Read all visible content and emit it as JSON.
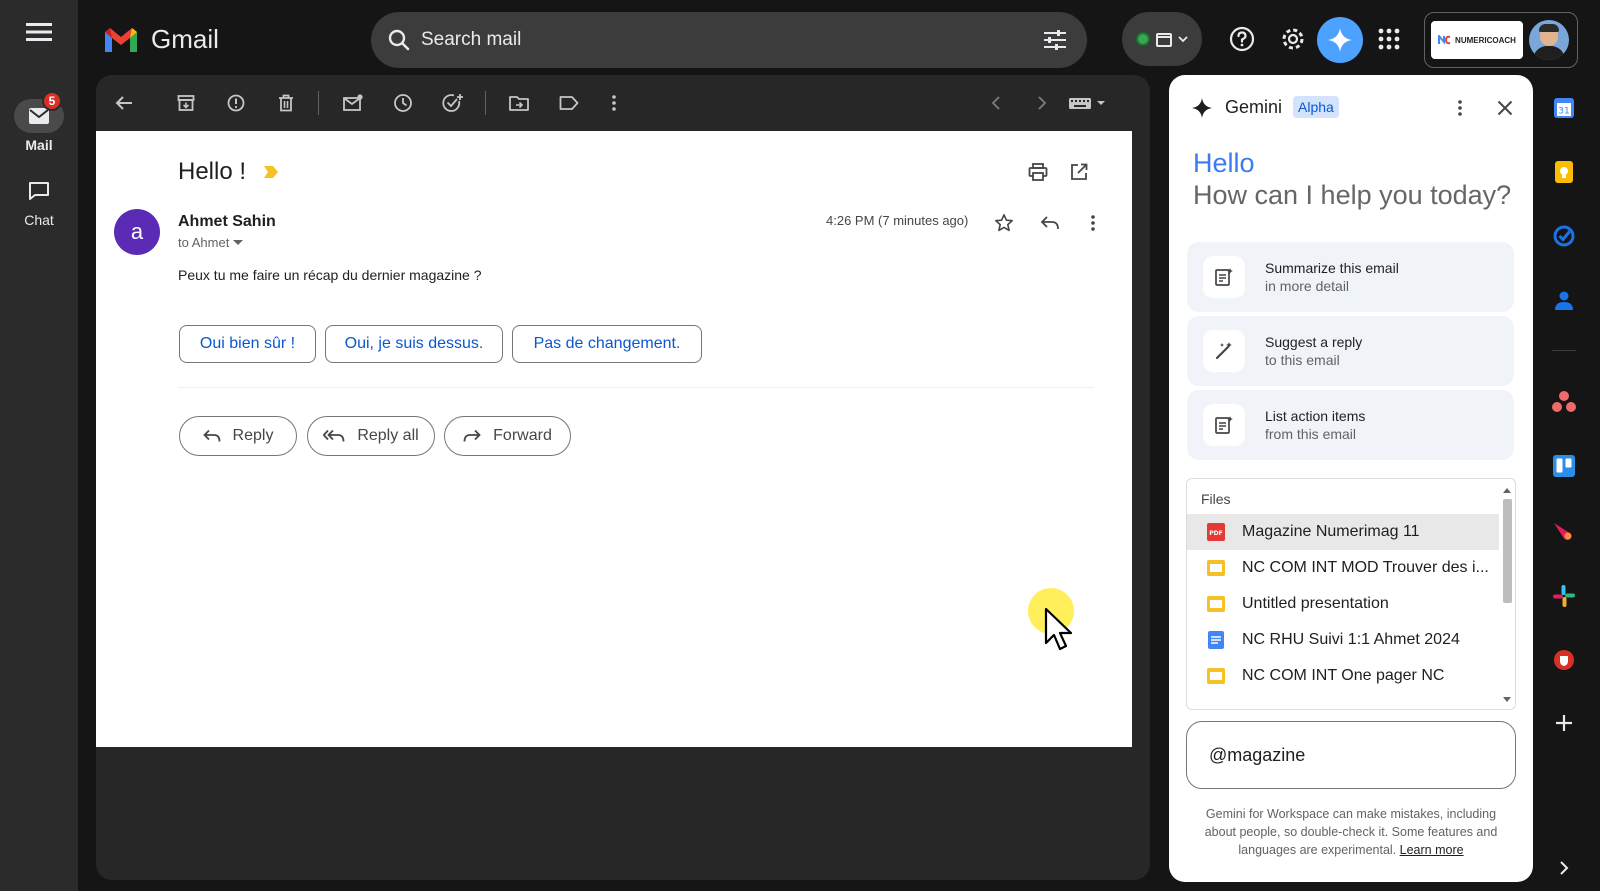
{
  "app": {
    "name": "Gmail"
  },
  "rail": {
    "items": [
      {
        "label": "Mail",
        "badge": "5"
      },
      {
        "label": "Chat"
      }
    ]
  },
  "search": {
    "placeholder": "Search mail"
  },
  "account": {
    "brand": "NUMERICOACH"
  },
  "email": {
    "subject": "Hello !",
    "sender": "Ahmet Sahin",
    "avatar_letter": "a",
    "to": "to Ahmet",
    "timestamp": "4:26 PM (7 minutes ago)",
    "body": "Peux tu me faire un récap du dernier magazine ?",
    "smart_replies": [
      "Oui bien sûr !",
      "Oui, je suis dessus.",
      "Pas de changement."
    ],
    "actions": [
      "Reply",
      "Reply all",
      "Forward"
    ]
  },
  "gemini": {
    "title": "Gemini",
    "badge": "Alpha",
    "greeting": "Hello",
    "prompt": "How can I help you today?",
    "suggestions": [
      {
        "line1": "Summarize this email",
        "line2": "in more detail"
      },
      {
        "line1": "Suggest a reply",
        "line2": "to this email"
      },
      {
        "line1": "List action items",
        "line2": "from this email"
      }
    ],
    "files_header": "Files",
    "files": [
      {
        "name": "Magazine Numerimag 11",
        "type": "pdf"
      },
      {
        "name": "NC COM INT MOD Trouver des i...",
        "type": "slides"
      },
      {
        "name": "Untitled presentation",
        "type": "slides"
      },
      {
        "name": "NC RHU Suivi 1:1 Ahmet 2024",
        "type": "docs"
      },
      {
        "name": "NC COM INT One pager NC",
        "type": "slides"
      }
    ],
    "input_value": "@magazine",
    "disclaimer": "Gemini for Workspace can make mistakes, including about people, so double-check it. Some features and languages are experimental.",
    "learn_more": "Learn more"
  },
  "colors": {
    "accent_blue": "#0b57d0",
    "gemini_blue": "#3c7bf0",
    "avatar_purple": "#5b2bb6",
    "badge_red": "#d93025",
    "label_yellow": "#f6c026"
  }
}
